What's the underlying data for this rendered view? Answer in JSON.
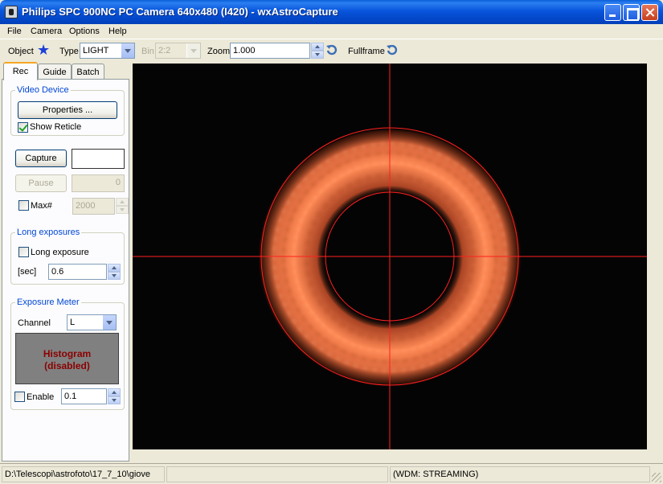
{
  "window": {
    "title": "Philips SPC 900NC PC Camera 640x480 (I420) - wxAstroCapture"
  },
  "menu": {
    "items": [
      "File",
      "Camera",
      "Options",
      "Help"
    ]
  },
  "toolbar": {
    "object_label": "Object",
    "object_icon": "star-icon",
    "type_label": "Type",
    "type_value": "LIGHT",
    "bin_label": "Bin",
    "bin_value": "2:2",
    "zoom_label": "Zoom",
    "zoom_value": "1.000",
    "fullframe_label": "Fullframe"
  },
  "tabs": [
    {
      "label": "Rec",
      "active": true
    },
    {
      "label": "Guide",
      "active": false
    },
    {
      "label": "Batch",
      "active": false
    }
  ],
  "rec": {
    "video_device": {
      "title": "Video Device",
      "properties_label": "Properties ...",
      "show_reticle_label": "Show Reticle",
      "show_reticle_checked": true
    },
    "capture_label": "Capture",
    "capture_value": "",
    "pause_label": "Pause",
    "pause_count": "0",
    "max_label": "Max#",
    "max_value": "2000",
    "max_checked": false,
    "long_exposures": {
      "title": "Long exposures",
      "long_exposure_label": "Long exposure",
      "long_exposure_checked": false,
      "sec_label": "[sec]",
      "sec_value": "0.6"
    },
    "exposure_meter": {
      "title": "Exposure Meter",
      "channel_label": "Channel",
      "channel_value": "L",
      "histogram_line1": "Histogram",
      "histogram_line2": "(disabled)",
      "enable_label": "Enable",
      "enable_checked": false,
      "enable_value": "0.1"
    }
  },
  "status": {
    "path": "D:\\Telescopi\\astrofoto\\17_7_10\\giove",
    "middle": "",
    "stream": "(WDM: STREAMING)"
  },
  "colors": {
    "reticle": "#ff2020",
    "ring": "#ff7a45",
    "title_bar": "#0a5fd8"
  }
}
